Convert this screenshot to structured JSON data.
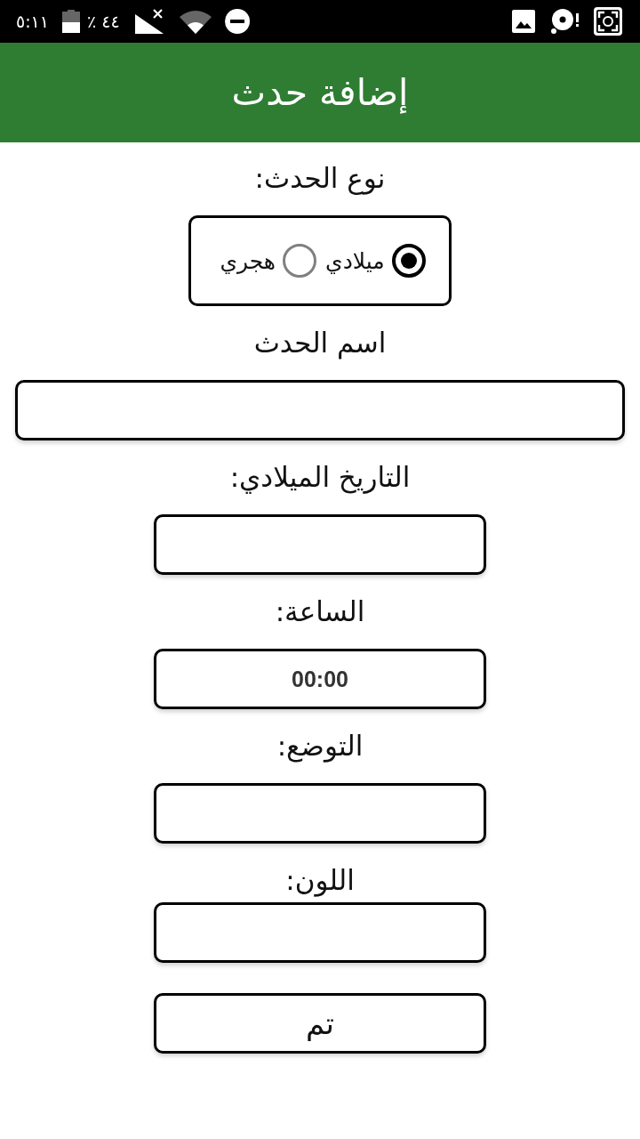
{
  "status_bar": {
    "time": "٥:١١",
    "battery_text": "٪ ٤٤"
  },
  "app_bar": {
    "title": "إضافة حدث"
  },
  "form": {
    "event_type": {
      "label": "نوع الحدث:",
      "options": [
        {
          "label": "ميلادي",
          "selected": true
        },
        {
          "label": "هجري",
          "selected": false
        }
      ]
    },
    "fields": [
      {
        "label": "اسم الحدث",
        "kind": "wide"
      },
      {
        "label": "التاريخ الميلادي:",
        "kind": "narrow"
      },
      {
        "label": "الساعة:",
        "kind": "narrow",
        "value": "00:00"
      },
      {
        "label": "التوضع:",
        "kind": "narrow"
      },
      {
        "label": "اللون:",
        "kind": "narrow"
      }
    ],
    "submit_button": {
      "label": "تم"
    }
  }
}
